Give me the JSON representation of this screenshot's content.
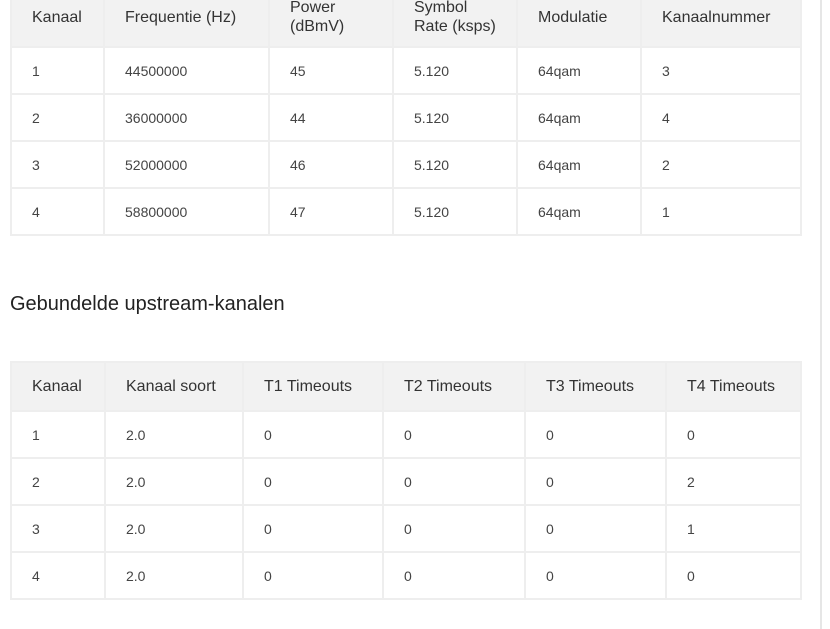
{
  "downstream": {
    "headers": [
      "Kanaal",
      "Frequentie (Hz)",
      "Power\n(dBmV)",
      "Symbol\nRate (ksps)",
      "Modulatie",
      "Kanaalnummer"
    ],
    "rows": [
      [
        "1",
        "44500000",
        "45",
        "5.120",
        "64qam",
        "3"
      ],
      [
        "2",
        "36000000",
        "44",
        "5.120",
        "64qam",
        "4"
      ],
      [
        "3",
        "52000000",
        "46",
        "5.120",
        "64qam",
        "2"
      ],
      [
        "4",
        "58800000",
        "47",
        "5.120",
        "64qam",
        "1"
      ]
    ]
  },
  "upstream": {
    "title": "Gebundelde upstream-kanalen",
    "headers": [
      "Kanaal",
      "Kanaal soort",
      "T1 Timeouts",
      "T2 Timeouts",
      "T3 Timeouts",
      "T4 Timeouts"
    ],
    "rows": [
      [
        "1",
        "2.0",
        "0",
        "0",
        "0",
        "0"
      ],
      [
        "2",
        "2.0",
        "0",
        "0",
        "0",
        "2"
      ],
      [
        "3",
        "2.0",
        "0",
        "0",
        "0",
        "1"
      ],
      [
        "4",
        "2.0",
        "0",
        "0",
        "0",
        "0"
      ]
    ]
  }
}
